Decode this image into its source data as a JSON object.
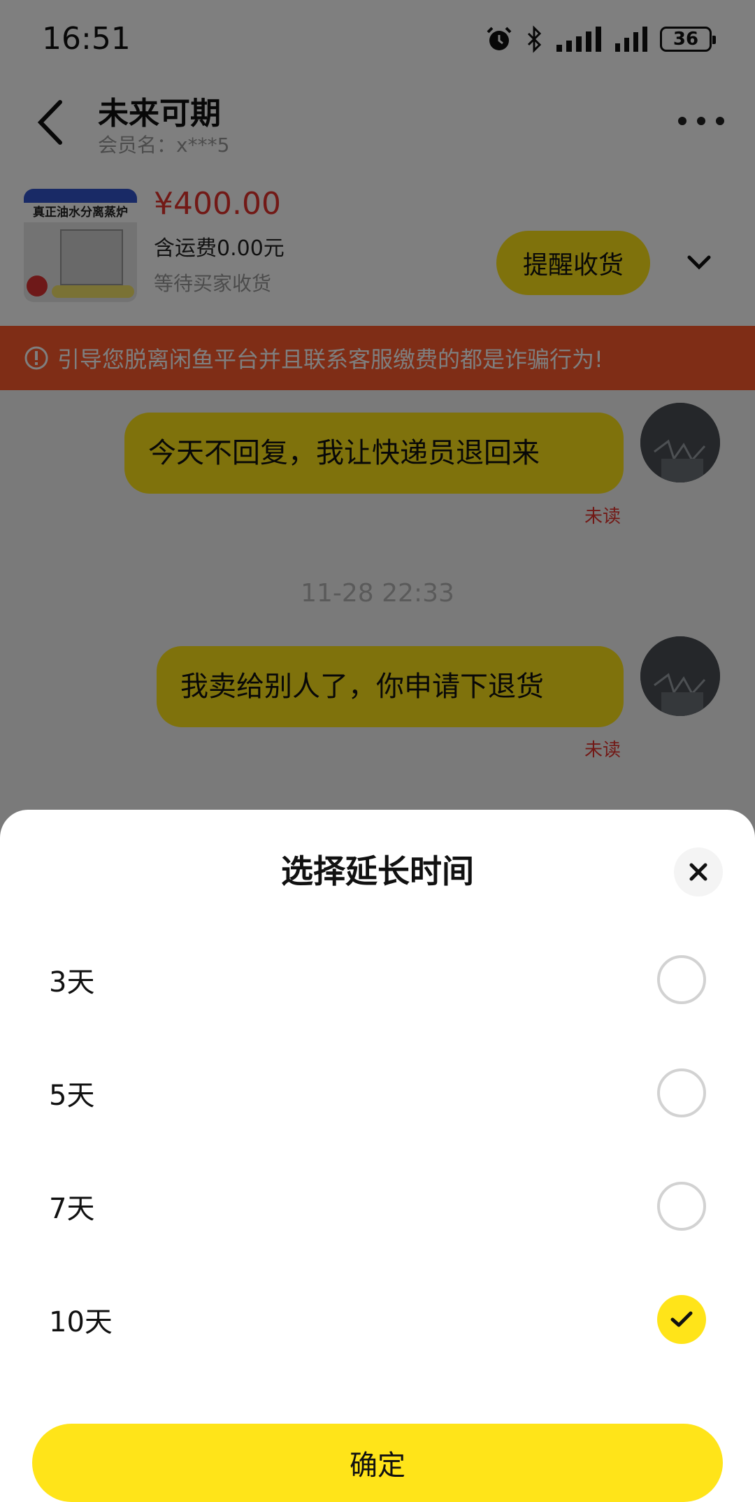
{
  "status_bar": {
    "time": "16:51",
    "battery": "36",
    "icons": [
      "alarm-icon",
      "bluetooth-icon",
      "signal-icon",
      "signal-icon",
      "battery-icon"
    ]
  },
  "header": {
    "title": "未来可期",
    "member_label": "会员名：x***5"
  },
  "product": {
    "thumb_title": "真正油水分离蒸炉",
    "price": "¥400.00",
    "shipping": "含运费0.00元",
    "status": "等待买家收货",
    "remind_button": "提醒收货"
  },
  "warning": {
    "text": "引导您脱离闲鱼平台并且联系客服缴费的都是诈骗行为!"
  },
  "messages": [
    {
      "text": "今天不回复，我让快递员退回来",
      "status": "未读"
    },
    {
      "text": "我卖给别人了，你申请下退货",
      "status": "未读"
    }
  ],
  "timestamp": "11-28 22:33",
  "sheet": {
    "title": "选择延长时间",
    "options": [
      {
        "label": "3天",
        "selected": false
      },
      {
        "label": "5天",
        "selected": false
      },
      {
        "label": "7天",
        "selected": false
      },
      {
        "label": "10天",
        "selected": true
      }
    ],
    "confirm_label": "确定"
  },
  "colors": {
    "accent": "#ffe419",
    "warning": "#ff5a2c",
    "price": "#e5322d"
  }
}
